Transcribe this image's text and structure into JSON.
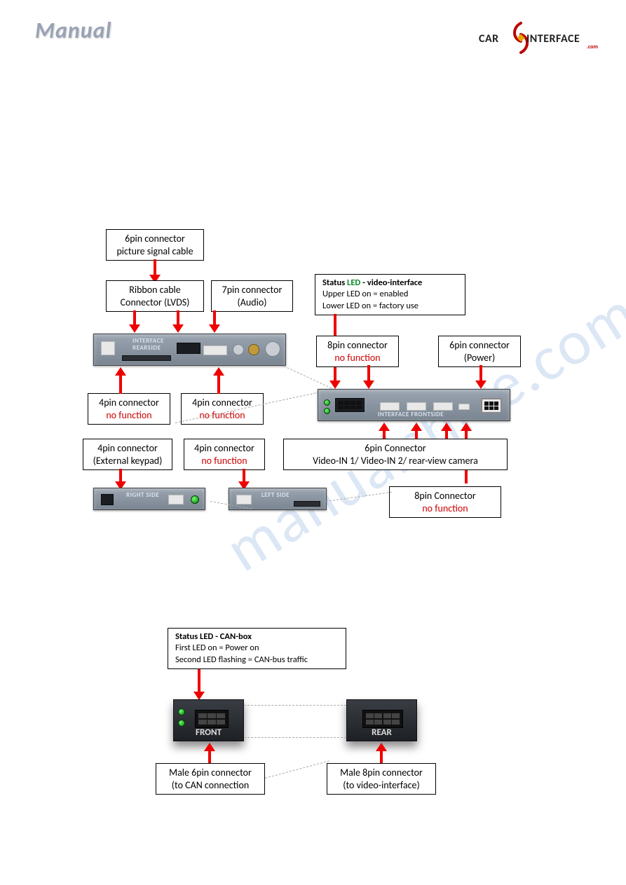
{
  "header": {
    "manual_title": "Manual",
    "logo": {
      "car": "CAR",
      "interface": "INTERFACE",
      "dotcom": ".com"
    }
  },
  "watermark": "manualshive.com",
  "diagram1": {
    "box_6pin_picture": {
      "l1": "6pin connector",
      "l2": "picture signal cable"
    },
    "box_ribbon_lvds": {
      "l1": "Ribbon cable",
      "l2": "Connector (LVDS)"
    },
    "box_7pin_audio": {
      "l1": "7pin connector",
      "l2": "(Audio)"
    },
    "box_status_led_video": {
      "l1a": "Status ",
      "l1b": "LED",
      "l1c": " - video-interface",
      "l2": "Upper LED on =  enabled",
      "l3": "Lower LED on =  factory use"
    },
    "box_8pin_nf": {
      "l1": "8pin connector",
      "l2": "no function"
    },
    "box_6pin_power": {
      "l1": "6pin connector",
      "l2": "(Power)"
    },
    "box_4pin_nf_left": {
      "l1": "4pin connector",
      "l2": "no function"
    },
    "box_4pin_nf_mid": {
      "l1": "4pin connector",
      "l2": "no function"
    },
    "box_4pin_ext_keypad": {
      "l1": "4pin connector",
      "l2": "(External keypad)"
    },
    "box_4pin_nf_bottom": {
      "l1": "4pin connector",
      "l2": "no function"
    },
    "box_6pin_video": {
      "l1": "6pin Connector",
      "l2": "Video-IN 1/ Video-IN 2/  rear-view camera"
    },
    "box_8pin_nf_bottom": {
      "l1": "8pin Connector",
      "l2": "no function"
    },
    "hw_rearside_label_l1": "INTERFACE",
    "hw_rearside_label_l2": "REARSIDE",
    "hw_frontside_label": "INTERFACE  FRONTSIDE",
    "hw_rightside_label": "RIGHT SIDE",
    "hw_leftside_label": "LEFT SIDE"
  },
  "diagram2": {
    "box_status_canbox": {
      "l1": "Status LED - CAN-box",
      "l2": "First LED on = Power on",
      "l3": "Second LED flashing = CAN-bus traffic"
    },
    "box_male6_can": {
      "l1": "Male 6pin connector",
      "l2": "(to CAN connection"
    },
    "box_male8_video": {
      "l1": "Male 8pin connector",
      "l2": "(to video-interface)"
    },
    "front_label": "FRONT",
    "rear_label": "REAR"
  }
}
